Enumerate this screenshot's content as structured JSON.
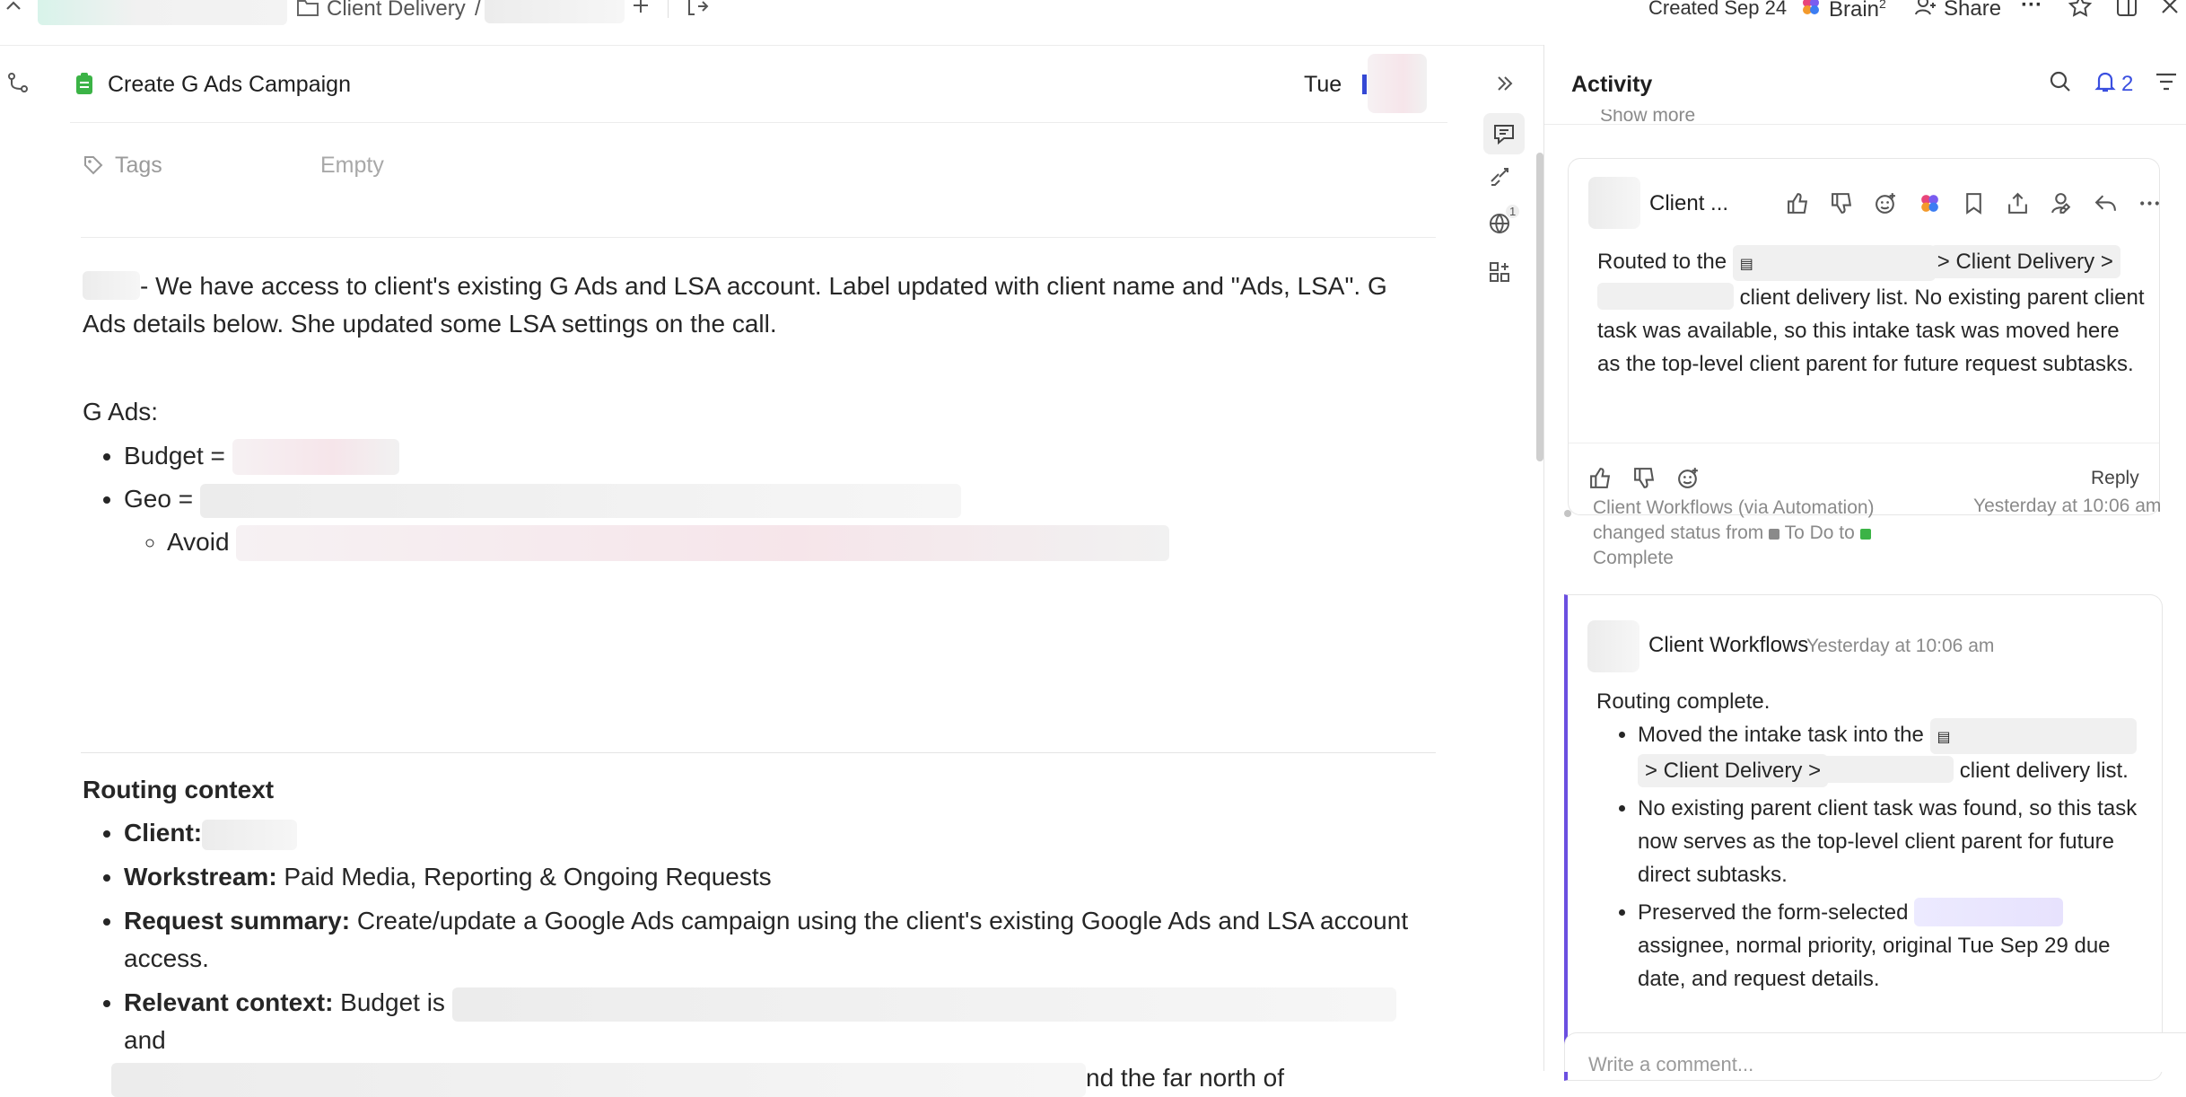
{
  "topbar": {
    "breadcrumb_client_delivery": "Client Delivery",
    "breadcrumb_separator": "/",
    "created_label": "Created Sep 24",
    "brain_label": "Brain",
    "brain_superscript": "2",
    "share_label": "Share",
    "more_label": "···"
  },
  "task": {
    "title": "Create G Ads Campaign",
    "due_day": "Tue",
    "tags_label": "Tags",
    "tags_value": "Empty",
    "status_icon_color": "#3bb346"
  },
  "description": {
    "intro_line": "- We have access to client's existing G Ads and LSA account.  Label updated with client name and \"Ads, LSA\".  G Ads details below.  She updated some LSA settings on the call.",
    "gads_heading": "G Ads:",
    "budget_label": "Budget =",
    "geo_label": "Geo =",
    "avoid_label": "Avoid"
  },
  "routing": {
    "heading": "Routing context",
    "client_label": "Client:",
    "workstream_label": "Workstream:",
    "workstream_value": " Paid Media, Reporting & Ongoing Requests",
    "request_label": "Request summary:",
    "request_value": " Create/update a Google Ads campaign using the client's existing Google Ads and LSA account access.",
    "context_label": "Relevant context:",
    "context_value_start": " Budget is",
    "context_value_and": "and",
    "context_value_end": "nd the far north of"
  },
  "activity": {
    "title": "Activity",
    "notification_count": "2",
    "show_more": "Show more",
    "accent_color": "#6b4fe0",
    "comment1": {
      "author": "Client ...",
      "routed_prefix": "Routed to the",
      "routed_path": "> Client Delivery >",
      "routed_rest": "client delivery list. No existing parent client task was available, so this intake task was moved here as the top-level client parent for future request subtasks.",
      "reply_label": "Reply"
    },
    "status_change": {
      "text_1": "Client Workflows (via Automation) changed status from",
      "from_status": "To Do",
      "to_word": "to",
      "to_status": "Complete",
      "timestamp": "Yesterday at 10:06 am",
      "from_color": "#8a8a8a",
      "to_color": "#3bb346"
    },
    "comment2": {
      "author": "Client Workflows",
      "timestamp": "Yesterday at 10:06 am",
      "heading": "Routing complete.",
      "bullet1_prefix": "Moved the intake task into the",
      "bullet1_path": "> Client Delivery >",
      "bullet1_rest": "client delivery list.",
      "bullet2": "No existing parent client task was found, so this task now serves as the top-level client parent for future direct subtasks.",
      "bullet3_prefix": "Preserved the form-selected",
      "bullet3_rest": "assignee, normal priority, original Tue Sep 29 due date, and request details."
    },
    "comment_placeholder": "Write a comment..."
  }
}
